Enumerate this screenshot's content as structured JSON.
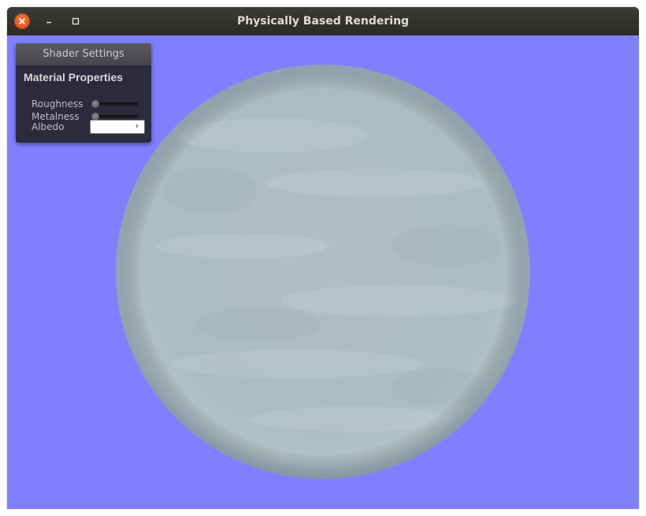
{
  "window": {
    "title": "Physically Based Rendering",
    "icons": {
      "close": "close-icon",
      "minimize": "minimize-icon",
      "maximize": "maximize-icon"
    }
  },
  "viewport": {
    "background_color": "#8080ff",
    "sphere_color": "#a9bcc1"
  },
  "panel": {
    "header": "Shader Settings",
    "group_title": "Material Properties",
    "properties": [
      {
        "label": "Roughness",
        "value": 0.0
      },
      {
        "label": "Metalness",
        "value": 0.0
      }
    ],
    "albedo": {
      "label": "Albedo",
      "color": "#ffffff",
      "icon": "chevron-right-icon",
      "chevron": "›"
    }
  }
}
